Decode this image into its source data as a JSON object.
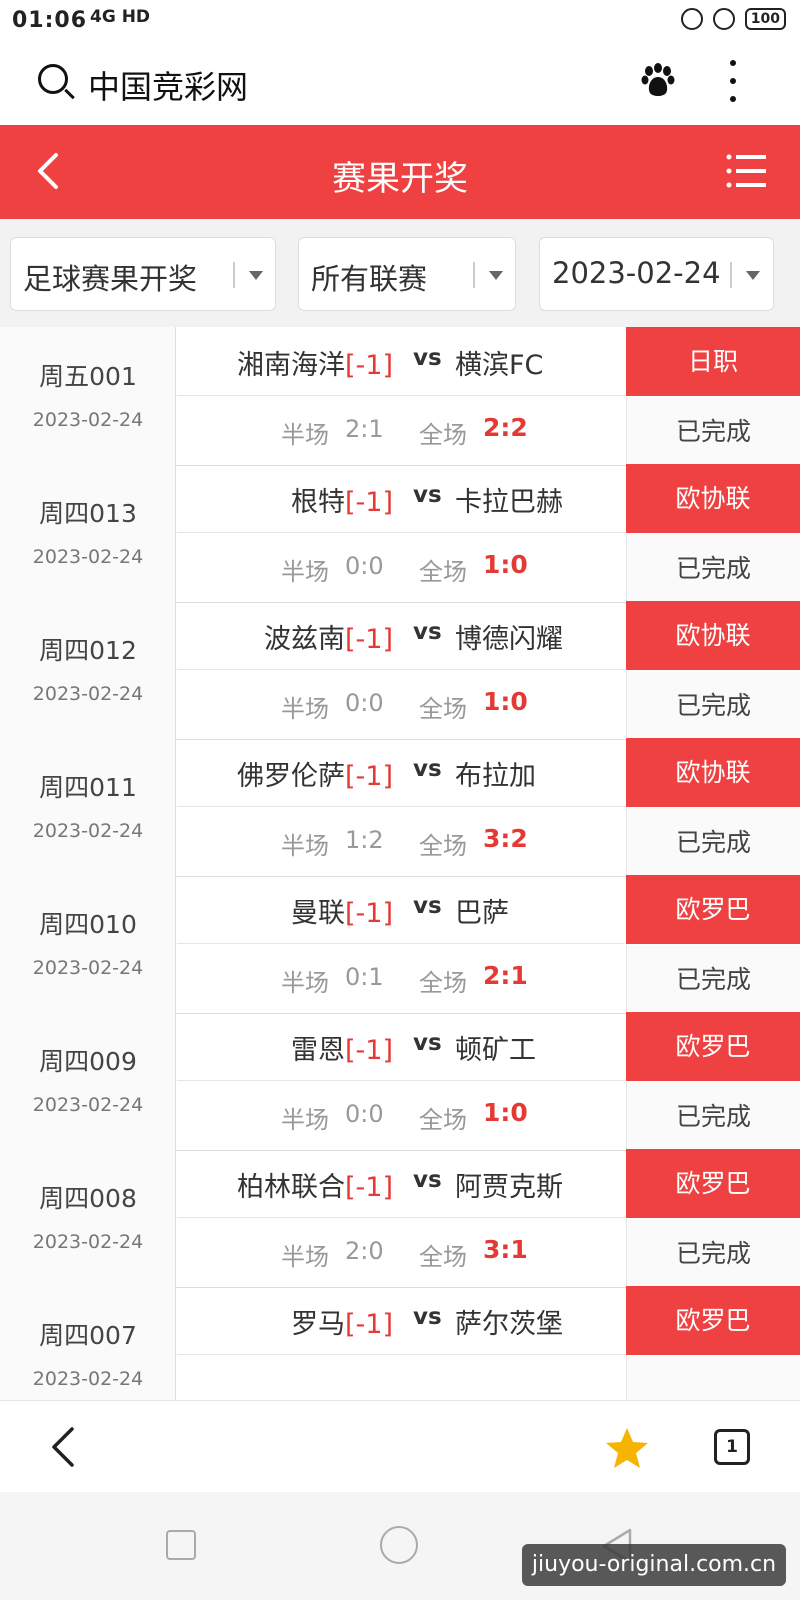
{
  "status_bar": {
    "time": "01:06",
    "signal": "4G HD",
    "battery": "100"
  },
  "browser": {
    "title": "中国竞彩网"
  },
  "header": {
    "title": "赛果开奖"
  },
  "filters": [
    {
      "label": "足球赛果开奖"
    },
    {
      "label": "所有联赛"
    },
    {
      "label": "2023-02-24"
    }
  ],
  "matches": [
    {
      "code": "周五001",
      "date": "2023-02-24",
      "home": "湘南海洋",
      "handicap": "[-1]",
      "vs": "vs",
      "away": "横滨FC",
      "league": "日职",
      "ht_label": "半场",
      "ht": "2:1",
      "ft_label": "全场",
      "ft": "2:2",
      "status": "已完成"
    },
    {
      "code": "周四013",
      "date": "2023-02-24",
      "home": "根特",
      "handicap": "[-1]",
      "vs": "vs",
      "away": "卡拉巴赫",
      "league": "欧协联",
      "ht_label": "半场",
      "ht": "0:0",
      "ft_label": "全场",
      "ft": "1:0",
      "status": "已完成"
    },
    {
      "code": "周四012",
      "date": "2023-02-24",
      "home": "波兹南",
      "handicap": "[-1]",
      "vs": "vs",
      "away": "博德闪耀",
      "league": "欧协联",
      "ht_label": "半场",
      "ht": "0:0",
      "ft_label": "全场",
      "ft": "1:0",
      "status": "已完成"
    },
    {
      "code": "周四011",
      "date": "2023-02-24",
      "home": "佛罗伦萨",
      "handicap": "[-1]",
      "vs": "vs",
      "away": "布拉加",
      "league": "欧协联",
      "ht_label": "半场",
      "ht": "1:2",
      "ft_label": "全场",
      "ft": "3:2",
      "status": "已完成"
    },
    {
      "code": "周四010",
      "date": "2023-02-24",
      "home": "曼联",
      "handicap": "[-1]",
      "vs": "vs",
      "away": "巴萨",
      "league": "欧罗巴",
      "ht_label": "半场",
      "ht": "0:1",
      "ft_label": "全场",
      "ft": "2:1",
      "status": "已完成"
    },
    {
      "code": "周四009",
      "date": "2023-02-24",
      "home": "雷恩",
      "handicap": "[-1]",
      "vs": "vs",
      "away": "顿矿工",
      "league": "欧罗巴",
      "ht_label": "半场",
      "ht": "0:0",
      "ft_label": "全场",
      "ft": "1:0",
      "status": "已完成"
    },
    {
      "code": "周四008",
      "date": "2023-02-24",
      "home": "柏林联合",
      "handicap": "[-1]",
      "vs": "vs",
      "away": "阿贾克斯",
      "league": "欧罗巴",
      "ht_label": "半场",
      "ht": "2:0",
      "ft_label": "全场",
      "ft": "3:1",
      "status": "已完成"
    },
    {
      "code": "周四007",
      "date": "2023-02-24",
      "home": "罗马",
      "handicap": "[-1]",
      "vs": "vs",
      "away": "萨尔茨堡",
      "league": "欧罗巴",
      "ht_label": "",
      "ht": "",
      "ft_label": "",
      "ft": "",
      "status": ""
    }
  ],
  "bottom_nav": {
    "tab_count": "1"
  },
  "watermark": "jiuyou-original.com.cn",
  "icons": {
    "search": "search-icon",
    "paw": "paw-icon",
    "more": "more-vertical-icon",
    "back": "chevron-left-icon",
    "menu": "menu-icon",
    "star": "star-icon",
    "tabs": "tabs-icon",
    "caret": "caret-down-icon"
  },
  "colors": {
    "accent": "#ef4141",
    "score": "#e53935",
    "star": "#f5b400"
  }
}
